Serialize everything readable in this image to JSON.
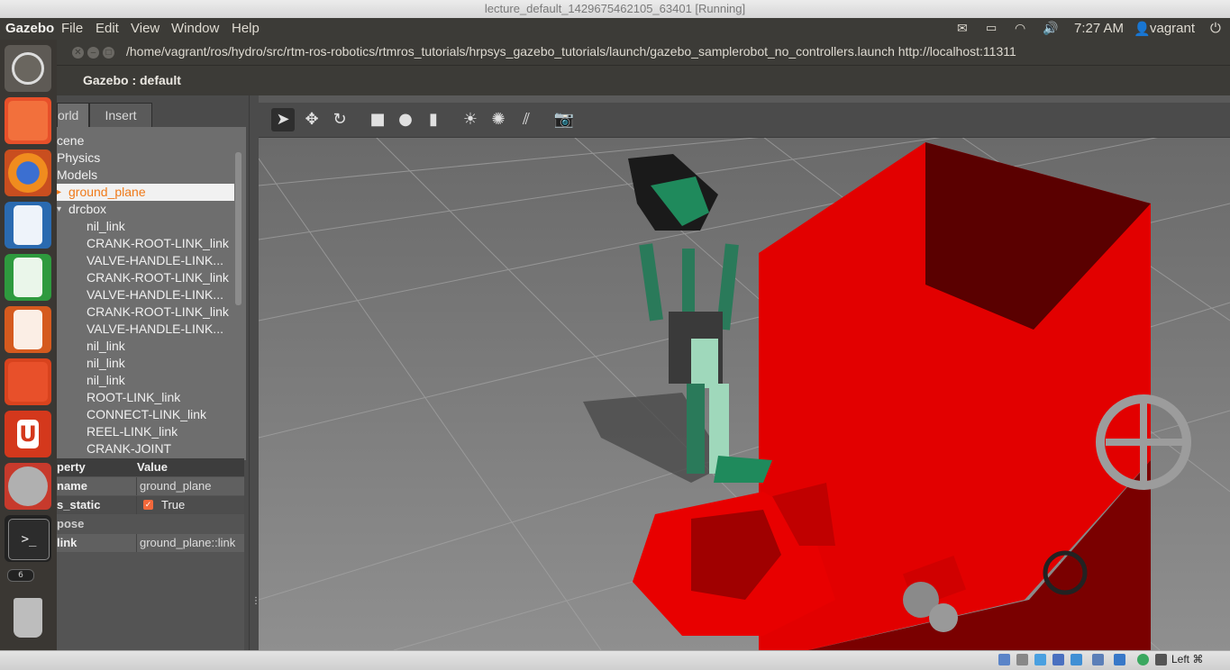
{
  "window": {
    "title": "lecture_default_1429675462105_63401 [Running]"
  },
  "topbar": {
    "app_name": "Gazebo",
    "menus": [
      "File",
      "Edit",
      "View",
      "Window",
      "Help"
    ],
    "time": "7:27 AM",
    "user": "vagrant"
  },
  "launcher": {
    "items": [
      "ubuntu-dash-icon",
      "files-icon",
      "firefox-icon",
      "writer-icon",
      "calc-icon",
      "impress-icon",
      "software-center-icon",
      "ubuntu-one-icon",
      "system-settings-icon",
      "terminal-icon",
      "workspace-icon",
      "trash-icon"
    ],
    "workspace_count": "6"
  },
  "terminal_title": "/home/vagrant/ros/hydro/src/rtm-ros-robotics/rtmros_tutorials/hrpsys_gazebo_tutorials/launch/gazebo_samplerobot_no_controllers.launch http://localhost:11311",
  "gazebo_title": "Gazebo : default",
  "tabs": {
    "world": "orld",
    "insert": "Insert"
  },
  "tree": {
    "scene": "cene",
    "physics": "Physics",
    "models": "Models",
    "ground_plane": "ground_plane",
    "drcbox": "drcbox",
    "children": [
      "nil_link",
      "CRANK-ROOT-LINK_link",
      "VALVE-HANDLE-LINK...",
      "CRANK-ROOT-LINK_link",
      "VALVE-HANDLE-LINK...",
      "CRANK-ROOT-LINK_link",
      "VALVE-HANDLE-LINK...",
      "nil_link",
      "nil_link",
      "nil_link",
      "ROOT-LINK_link",
      "CONNECT-LINK_link",
      "REEL-LINK_link",
      "CRANK-JOINT"
    ]
  },
  "properties": {
    "header_property": "perty",
    "header_value": "Value",
    "name_label": "name",
    "name_value": "ground_plane",
    "static_label": "s_static",
    "static_value": "True",
    "pose_label": "pose",
    "link_label": "link",
    "link_value": "ground_plane::link"
  },
  "toolbar": [
    "select-arrow-icon",
    "translate-icon",
    "rotate-icon",
    "box-icon",
    "sphere-icon",
    "cylinder-icon",
    "point-light-icon",
    "spot-light-icon",
    "directional-light-icon",
    "screenshot-icon"
  ],
  "statusbar": {
    "host_key": "Left ⌘"
  },
  "colors": {
    "selection_text": "#f07a1a",
    "robot_green": "#1f8a5c",
    "box_red": "#e00000",
    "ground": "#8c8c8c"
  }
}
